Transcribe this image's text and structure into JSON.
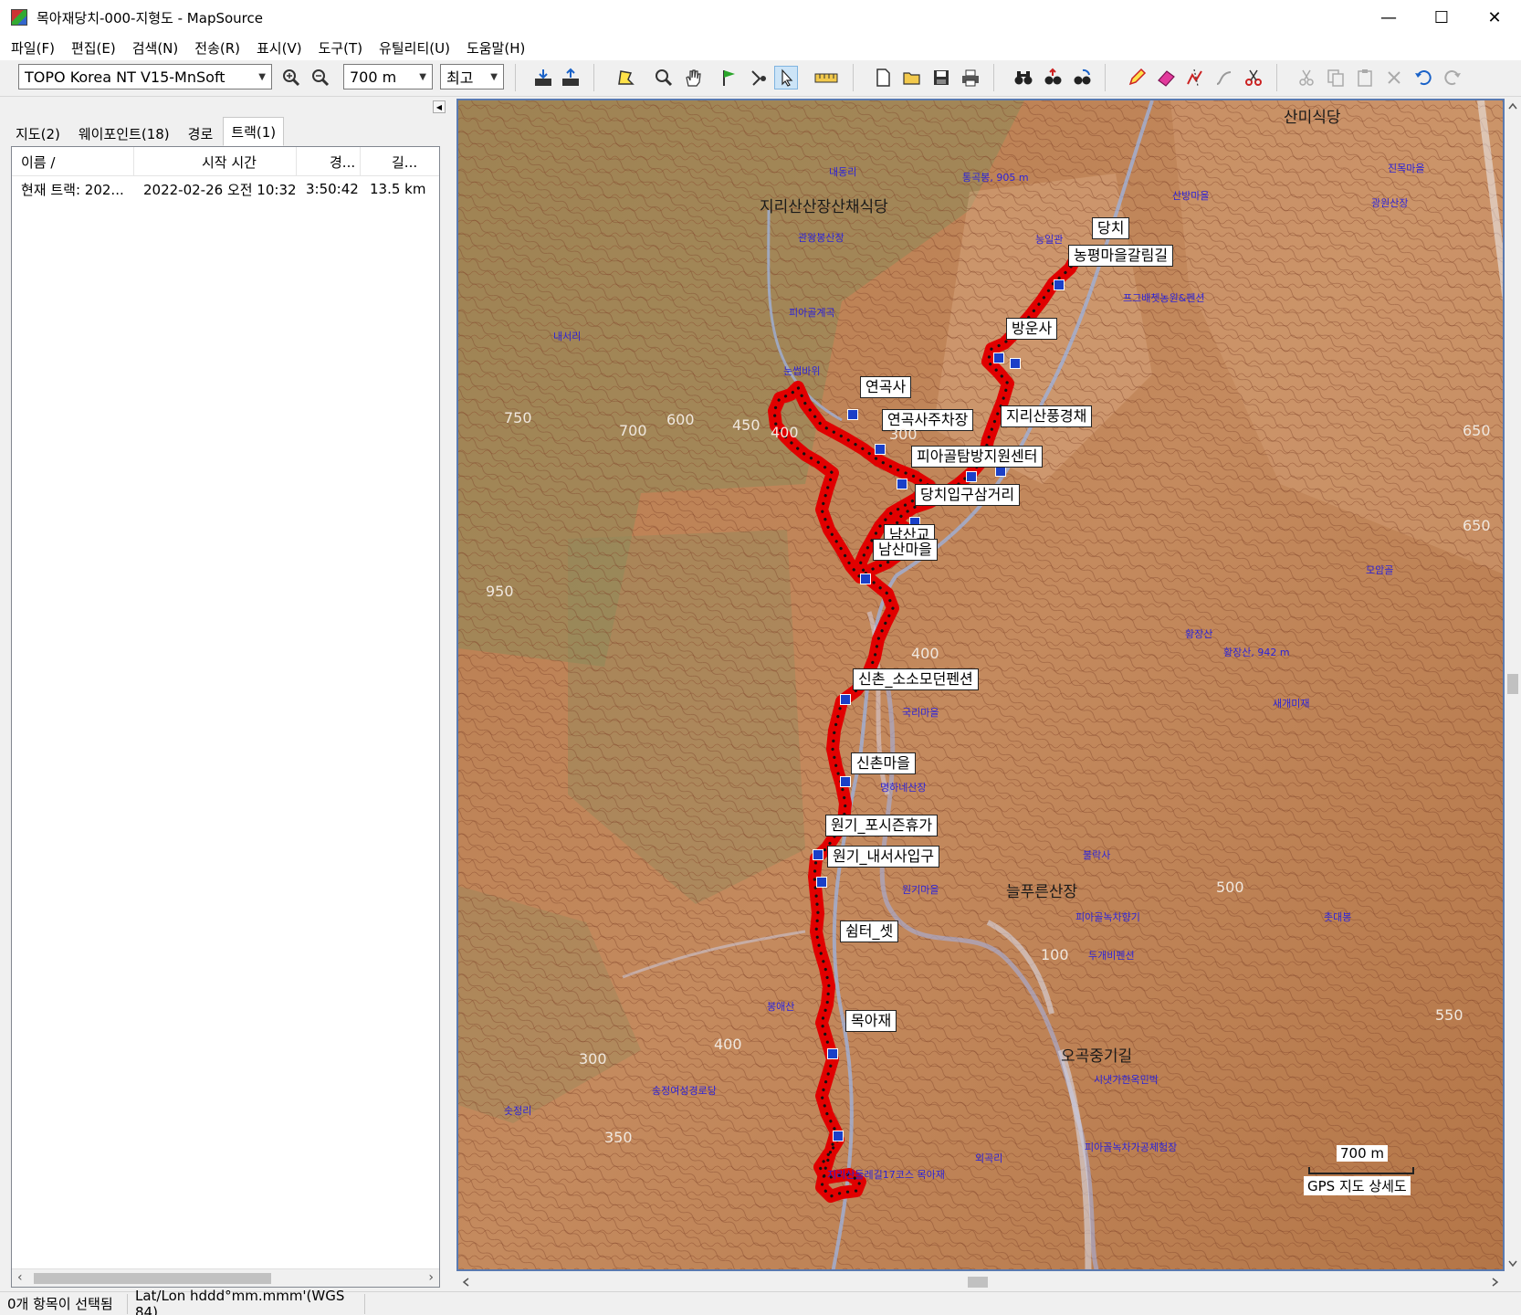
{
  "window": {
    "title": "목아재당치-000-지형도 - MapSource",
    "minimize": "—",
    "maximize": "☐",
    "close": "✕"
  },
  "menu": [
    "파일(F)",
    "편집(E)",
    "검색(N)",
    "전송(R)",
    "표시(V)",
    "도구(T)",
    "유틸리티(U)",
    "도움말(H)"
  ],
  "toolbar": {
    "map_product": "TOPO Korea NT V15-MnSoft",
    "zoom_scale": "700 m",
    "detail_level": "최고"
  },
  "tabs": [
    "지도(2)",
    "웨이포인트(18)",
    "경로",
    "트랙(1)"
  ],
  "active_tab_index": 3,
  "track_list": {
    "headers": [
      "이름  /",
      "시작 시간",
      "경...",
      "길..."
    ],
    "rows": [
      [
        "현재 트랙: 202...",
        "2022-02-26 오전 10:32...",
        "3:50:42",
        "13.5 km"
      ]
    ]
  },
  "map": {
    "waypoints": [
      "당치",
      "농평마을갈림길",
      "방운사",
      "연곡사",
      "연곡사주차장",
      "지리산풍경채",
      "피아골탐방지원센터",
      "당치입구삼거리",
      "남산교",
      "남산마을",
      "신촌_소소모던펜션",
      "신촌마을",
      "원기_포시즌휴가",
      "원기_내서사입구",
      "쉼터_셋",
      "목아재"
    ],
    "place_labels": [
      "지리산산장산채식당",
      "산미식당",
      "늘푸른산장",
      "오곡중기길"
    ],
    "contour_labels": [
      "750",
      "600",
      "700",
      "450",
      "400",
      "300",
      "650",
      "650",
      "950",
      "400",
      "500",
      "550",
      "100",
      "400",
      "300",
      "350"
    ],
    "poi_labels": [
      "내동리",
      "통곡봉, 905 m",
      "산방마을",
      "능일관",
      "관왕봉산장",
      "피아골계곡",
      "내서리",
      "눈썹바위",
      "프그배쳇농원&펜션",
      "황장산",
      "황장산, 942 m",
      "새개미재",
      "모암골",
      "국리마을",
      "명하네산장",
      "불락사",
      "피아골녹차향기",
      "두개비펜션",
      "원기마을",
      "봉애산",
      "솟정리",
      "송정여성경로당",
      "시냇가한옥민박",
      "피아골녹차가공체험장",
      "외곡리",
      "지리산둘레길17코스 목아재",
      "진목마을",
      "광원산장",
      "촛대봉"
    ],
    "scale_value": "700 m",
    "scale_caption": "GPS 지도 상세도"
  },
  "status": {
    "selection": "0개 항목이 선택됨",
    "coord_format": "Lat/Lon hddd°mm.mmm'(WGS 84)"
  }
}
